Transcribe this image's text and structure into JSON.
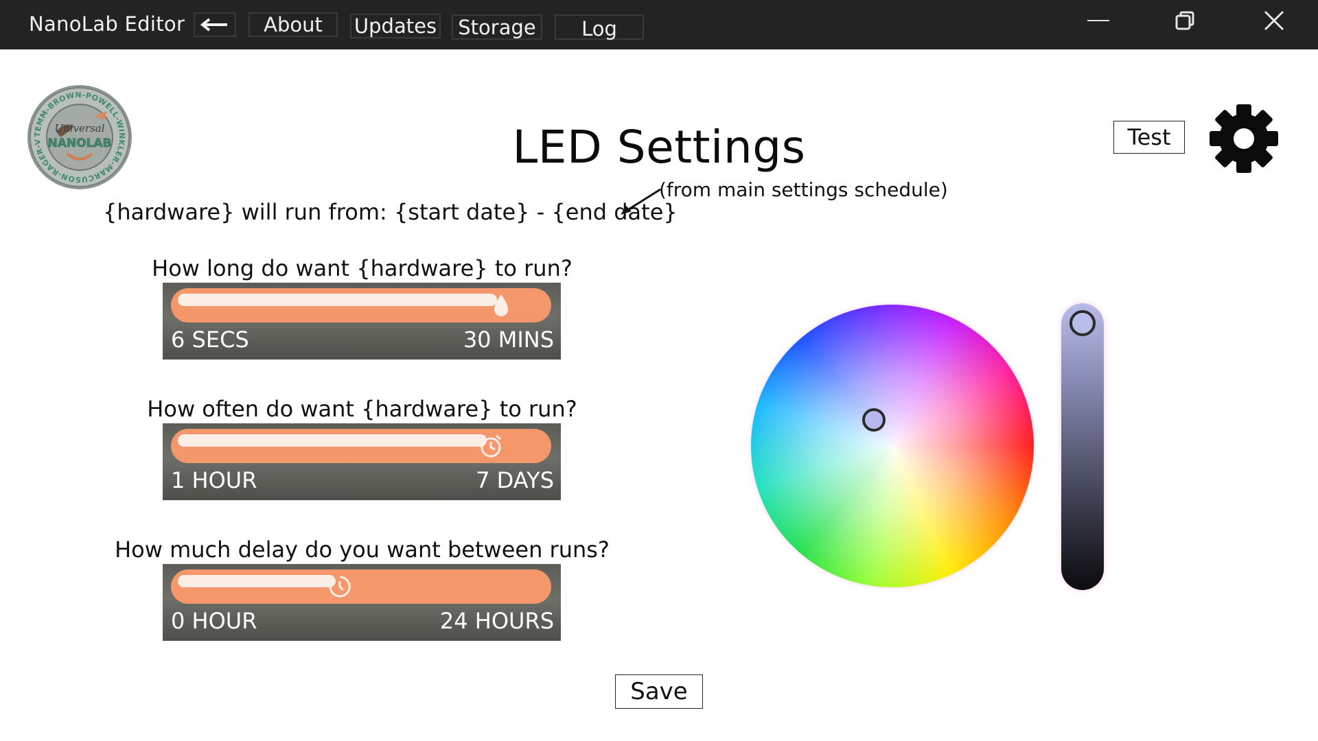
{
  "window": {
    "title": "NanoLab Editor",
    "nav_tabs": [
      {
        "label": "About"
      },
      {
        "label": "Updates"
      },
      {
        "label": "Storage"
      },
      {
        "label": "Log"
      }
    ]
  },
  "logo": {
    "ring_text": "TEMM-BROWN-POWELL-WINKLER-MARCUSON-RAGER-VAN HOUTEN-WELSH",
    "script_text": "Universal",
    "main_text": "NANOLAB"
  },
  "page": {
    "title": "LED Settings",
    "test_label": "Test",
    "run_range": "{hardware} will run from: {start date} - {end date}",
    "schedule_note": "(from main settings schedule)",
    "save_label": "Save"
  },
  "sliders": [
    {
      "question": "How long do want {hardware} to run?",
      "min_label": "6 SECS",
      "max_label": "30 MINS",
      "value_fraction": 0.93,
      "icon": "water-drop-icon"
    },
    {
      "question": "How often do want {hardware} to run?",
      "min_label": "1 HOUR",
      "max_label": "7 DAYS",
      "value_fraction": 0.9,
      "icon": "alarm-clock-icon"
    },
    {
      "question": "How much delay do you want between runs?",
      "min_label": "0 HOUR",
      "max_label": "24 HOURS",
      "value_fraction": 0.46,
      "icon": "timer-icon"
    }
  ],
  "color_picker": {
    "selected_color": "#b8b8ee",
    "brightness_fraction": 1.0
  },
  "colors": {
    "titlebar": "#232323",
    "slider_accent": "#f4976b"
  }
}
